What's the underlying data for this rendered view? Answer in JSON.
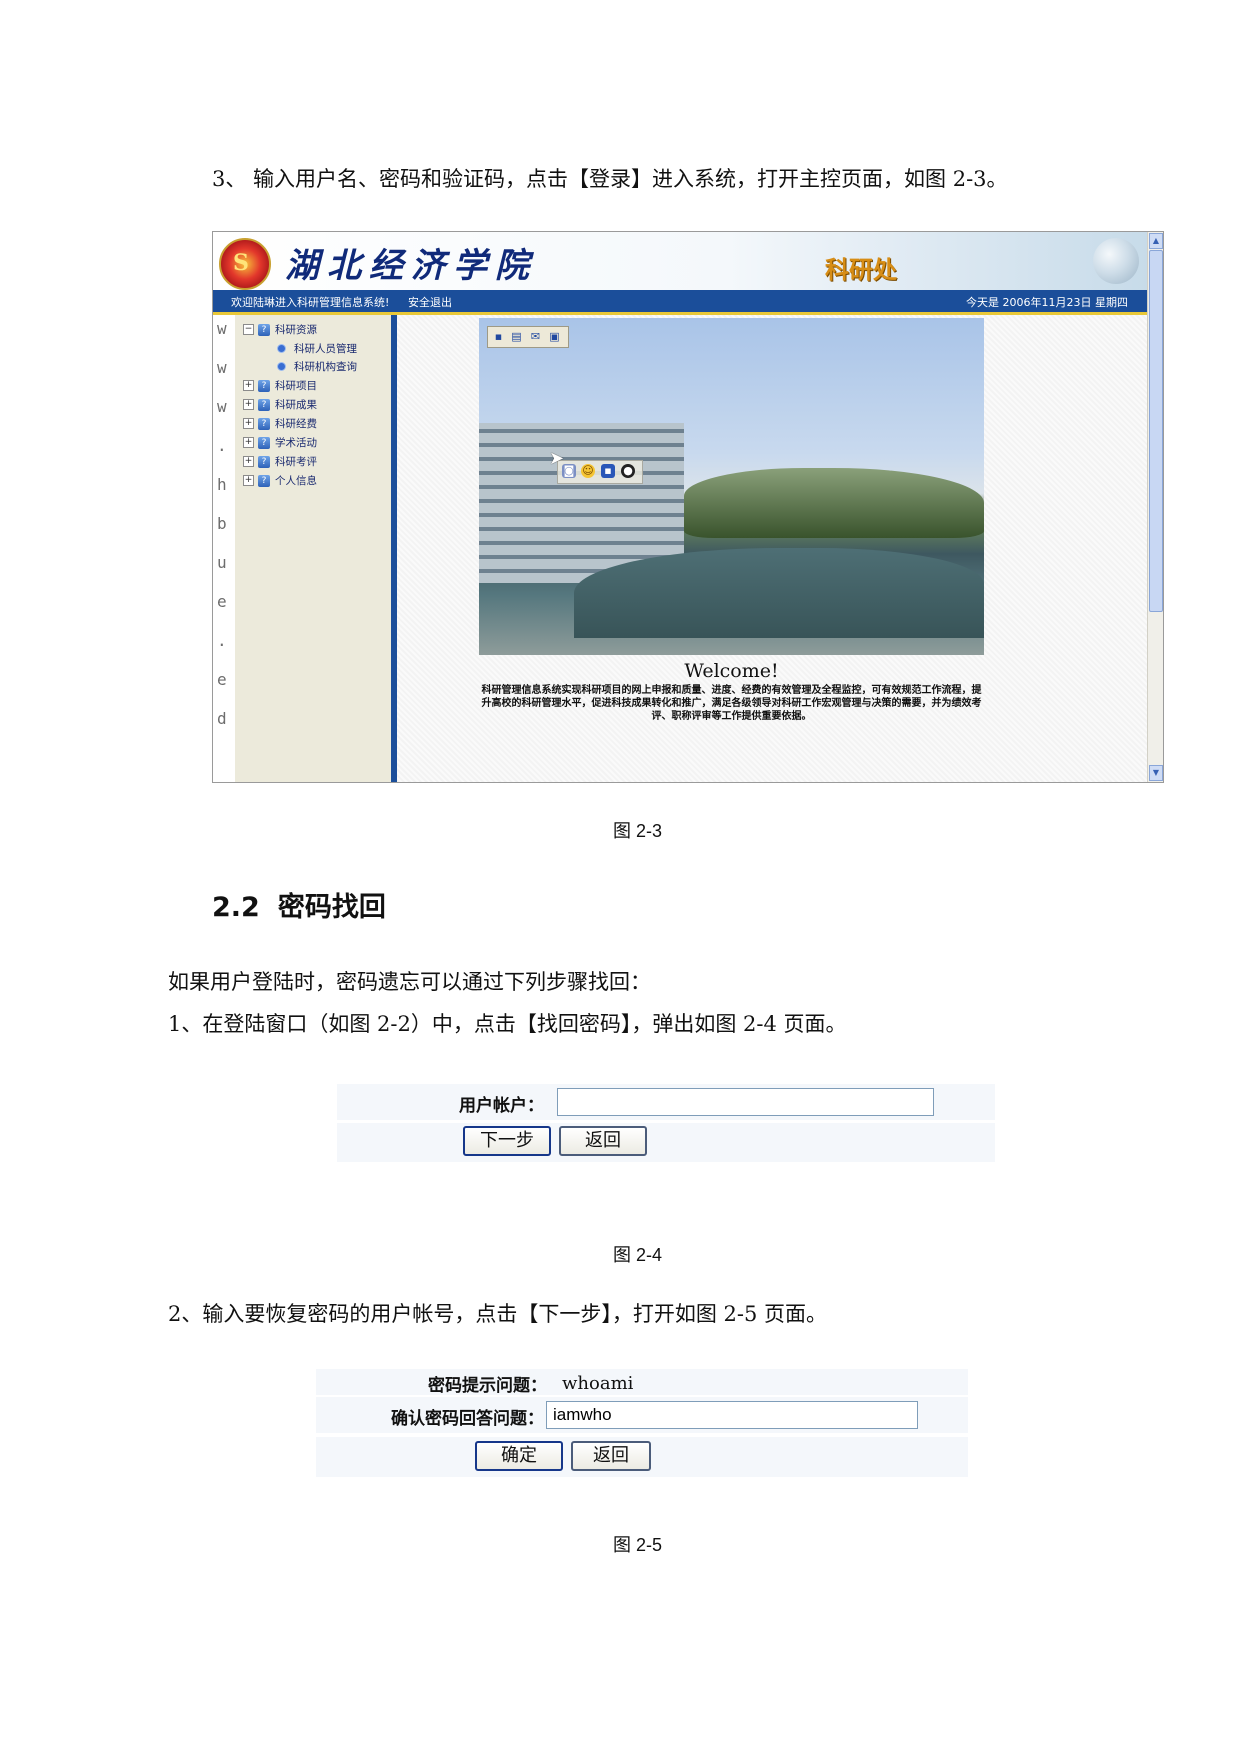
{
  "doc": {
    "step3": "3、 输入用户名、密码和验证码，点击【登录】进入系统，打开主控页面，如图 2-3。",
    "fig23_caption": "图 2-3",
    "section_number": "2.2",
    "section_title": "密码找回",
    "intro": "如果用户登陆时，密码遗忘可以通过下列步骤找回：",
    "step1": "1、在登陆窗口（如图 2-2）中，点击【找回密码】，弹出如图 2-4 页面。",
    "fig24_caption": "图 2-4",
    "step2": "2、输入要恢复密码的用户帐号，点击【下一步】，打开如图 2-5 页面。",
    "fig25_caption": "图 2-5"
  },
  "screenshot23": {
    "school_name": "湖北经济学院",
    "logo_letter": "S",
    "dept_name": "科研处",
    "nav_welcome": "欢迎陆琳进入科研管理信息系统!",
    "nav_logout": "安全退出",
    "nav_date": "今天是 2006年11月23日 星期四",
    "vertical_url": [
      "w",
      "w",
      "w",
      ".",
      "h",
      "b",
      "u",
      "e",
      ".",
      "e",
      "d"
    ],
    "tree": {
      "root": "科研资源",
      "children": [
        "科研人员管理",
        "科研机构查询"
      ],
      "items": [
        "科研项目",
        "科研成果",
        "科研经费",
        "学术活动",
        "科研考评",
        "个人信息"
      ]
    },
    "welcome": "Welcome!",
    "intro_line1": "科研管理信息系统实现科研项目的网上申报和质量、进度、经费的有效管理及全程监控，可有效规范工作流程，提",
    "intro_line2": "升高校的科研管理水平，促进科技成果转化和推广，满足各级领导对科研工作宏观管理与决策的需要，并为绩效考",
    "intro_line3": "评、职称评审等工作提供重要依据。",
    "toolbar_icons": [
      "save-icon",
      "print-icon",
      "email-icon",
      "folder-icon"
    ],
    "emoji_icons": [
      "camera-icon",
      "smile-icon",
      "save-icon",
      "qq-icon"
    ]
  },
  "form24": {
    "account_label": "用户帐户：",
    "account_value": "",
    "next_button": "下一步",
    "back_button": "返回"
  },
  "form25": {
    "question_label": "密码提示问题：",
    "question_value": "whoami",
    "answer_label": "确认密码回答问题：",
    "answer_value": "iamwho",
    "ok_button": "确定",
    "back_button": "返回"
  }
}
